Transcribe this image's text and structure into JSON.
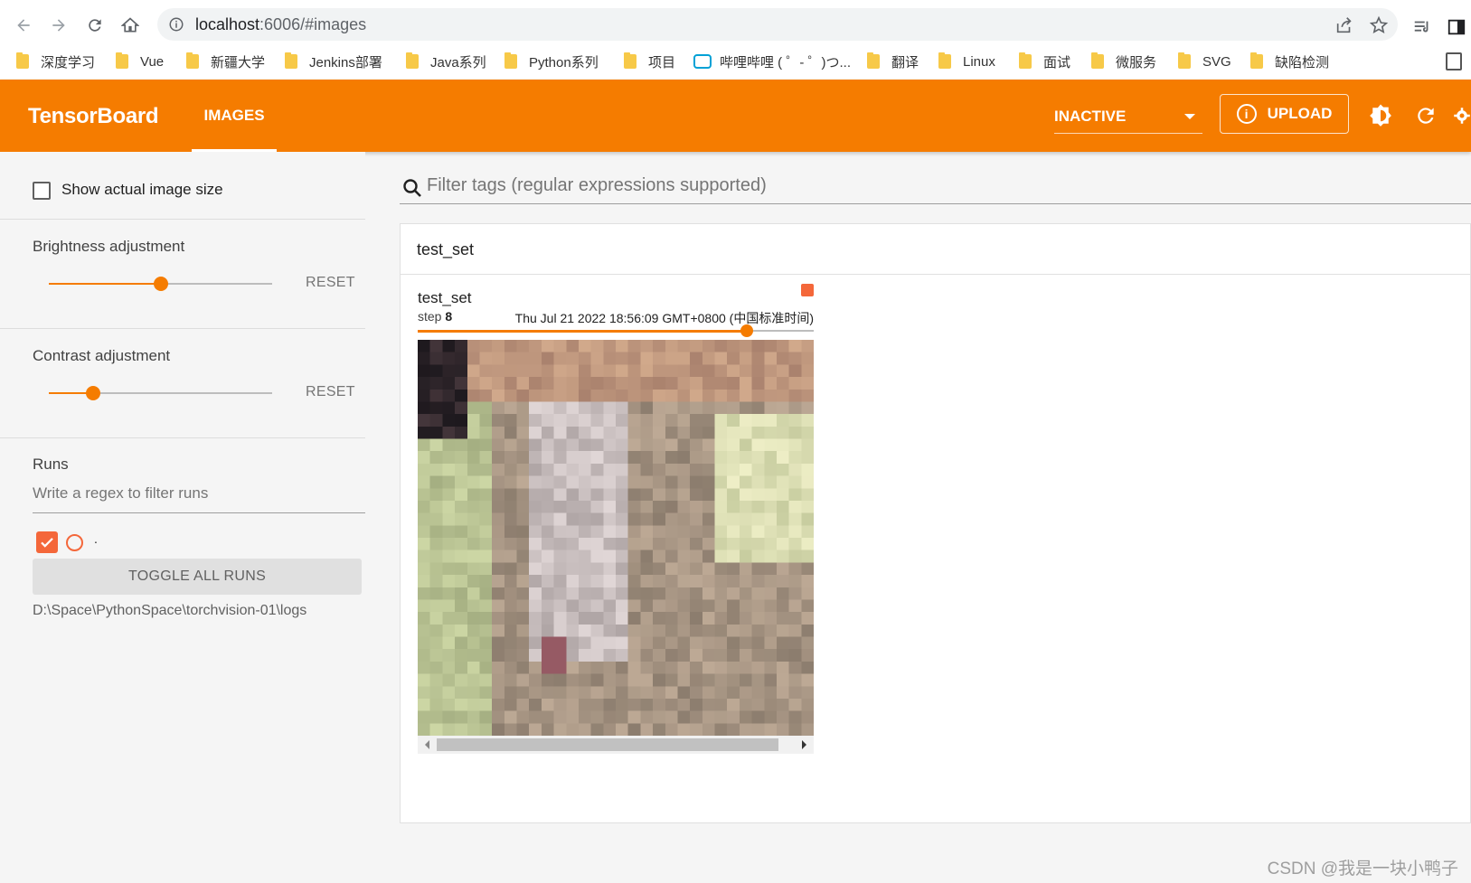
{
  "browser": {
    "url_host": "localhost",
    "url_port": ":6006",
    "url_path": "/#images",
    "bookmarks": [
      {
        "label": "深度学习",
        "icon": "folder-icon"
      },
      {
        "label": "Vue",
        "icon": "folder-icon"
      },
      {
        "label": "新疆大学",
        "icon": "folder-icon"
      },
      {
        "label": "Jenkins部署",
        "icon": "folder-icon"
      },
      {
        "label": "Java系列",
        "icon": "folder-icon"
      },
      {
        "label": "Python系列",
        "icon": "folder-icon"
      },
      {
        "label": "项目",
        "icon": "folder-icon"
      },
      {
        "label": "哔哩哔哩 ( ゜- ゜)つ...",
        "icon": "bilibili-icon"
      },
      {
        "label": "翻译",
        "icon": "folder-icon"
      },
      {
        "label": "Linux",
        "icon": "folder-icon"
      },
      {
        "label": "面试",
        "icon": "folder-icon"
      },
      {
        "label": "微服务",
        "icon": "folder-icon"
      },
      {
        "label": "SVG",
        "icon": "folder-icon"
      },
      {
        "label": "缺陷检测",
        "icon": "folder-icon"
      }
    ]
  },
  "header": {
    "brand": "TensorBoard",
    "tab": "IMAGES",
    "run_select": "INACTIVE",
    "upload": "UPLOAD",
    "accent": "#f57c00"
  },
  "sidebar": {
    "show_actual_size": "Show actual image size",
    "brightness": {
      "title": "Brightness adjustment",
      "reset": "RESET",
      "value": 0.5
    },
    "contrast": {
      "title": "Contrast adjustment",
      "reset": "RESET",
      "value": 0.2
    },
    "runs": {
      "title": "Runs",
      "placeholder": "Write a regex to filter runs",
      "run_name": ".",
      "run_color": "#f4673a",
      "toggle": "TOGGLE ALL RUNS",
      "logdir": "D:\\Space\\PythonSpace\\torchvision-01\\logs"
    }
  },
  "main": {
    "filter_placeholder": "Filter tags (regular expressions supported)",
    "card_title": "test_set",
    "image_card": {
      "tag": "test_set",
      "step_label": "step",
      "step_value": "8",
      "timestamp": "Thu Jul 21 2022 18:56:09 GMT+0800 (中国标准时间)",
      "step_fraction": 0.83
    }
  },
  "watermark": "CSDN @我是一块小鸭子"
}
